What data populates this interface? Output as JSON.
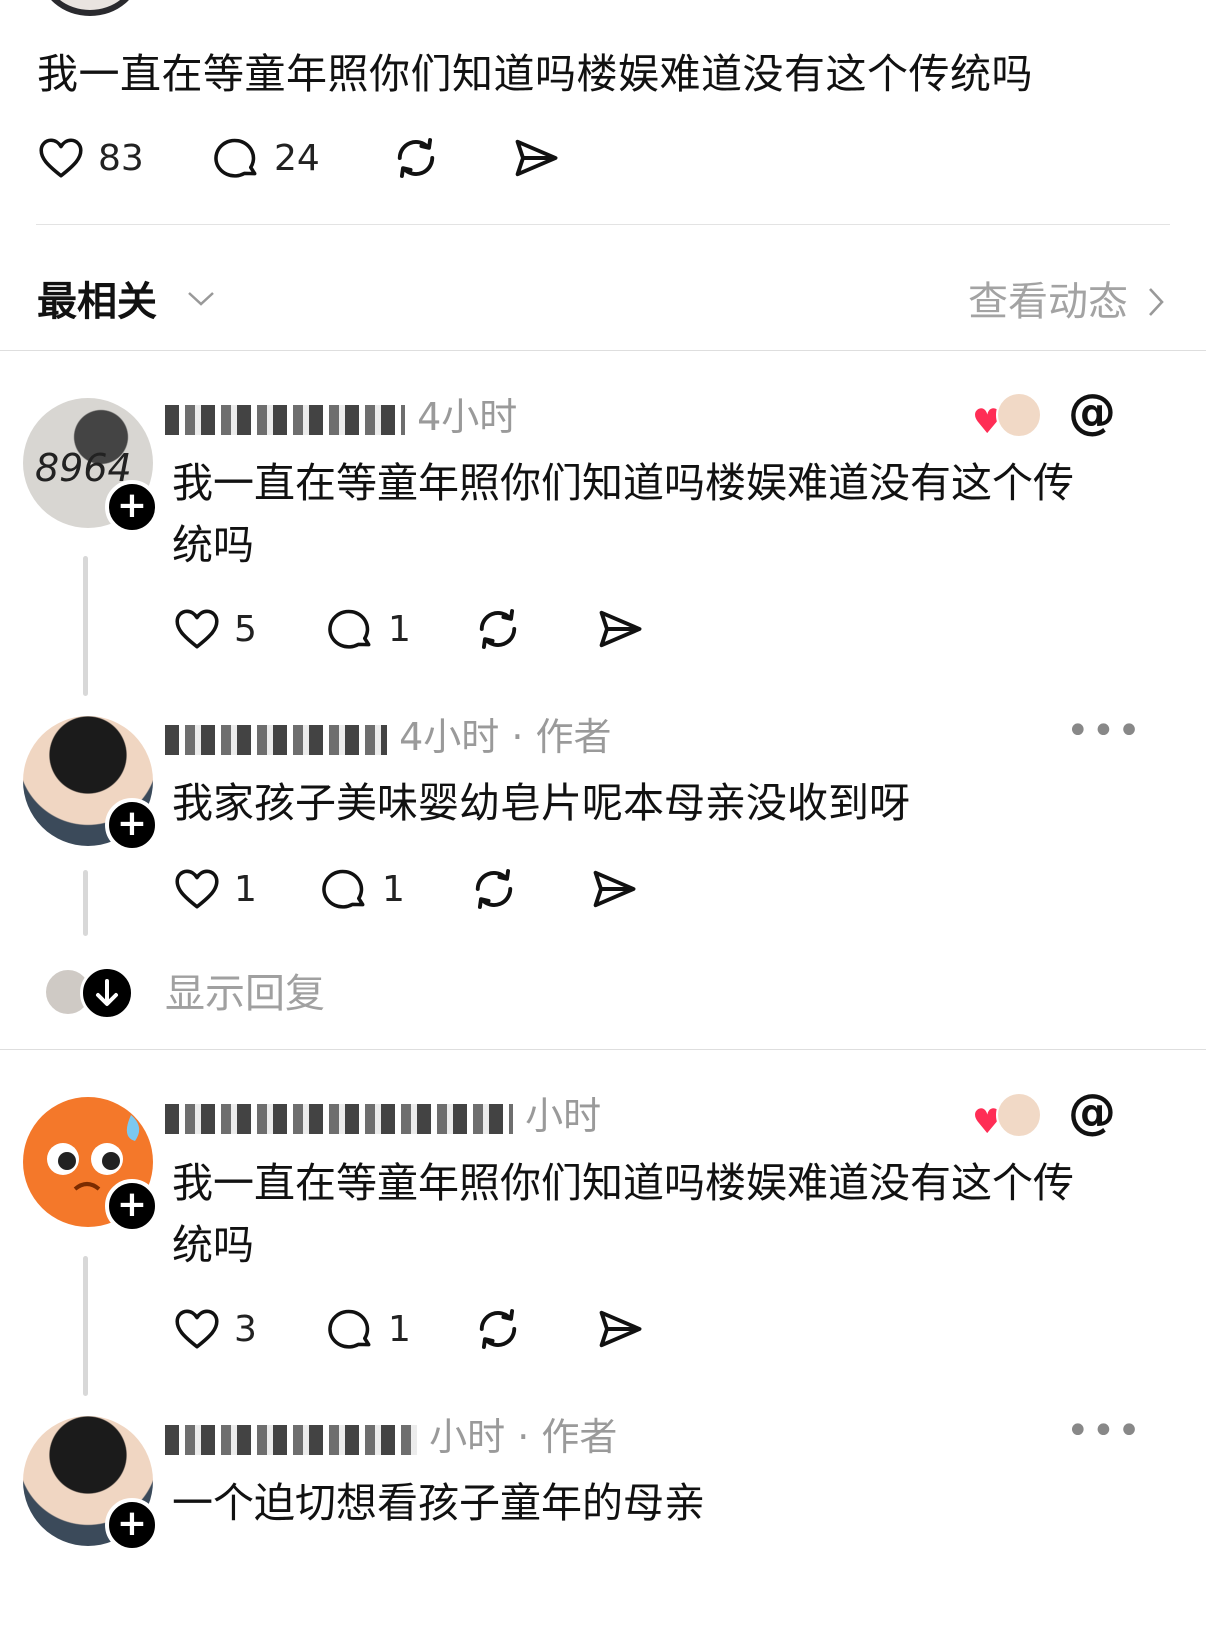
{
  "post": {
    "text": "我一直在等童年照你们知道吗楼娱难道没有这个传统吗",
    "likes": "83",
    "comments": "24"
  },
  "sort": {
    "label": "最相关",
    "activity": "查看动态"
  },
  "comments": [
    {
      "avatar_text": "8964",
      "time": "4小时",
      "author_tag": "",
      "text_line1": "我一直在等童年照你们知道吗楼娱难道没有这个传",
      "text_line2": "统吗",
      "likes": "5",
      "replies": "1"
    },
    {
      "time": "4小时",
      "author_tag": "· 作者",
      "text": "我家孩子美味婴幼皂片呢本母亲没收到呀",
      "likes": "1",
      "replies": "1"
    },
    {
      "time": "小时",
      "author_tag": "",
      "text_line1": "我一直在等童年照你们知道吗楼娱难道没有这个传",
      "text_line2": "统吗",
      "likes": "3",
      "replies": "1"
    },
    {
      "time": "小时",
      "author_tag": "· 作者",
      "text": "一个迫切想看孩子童年的母亲"
    }
  ],
  "show_replies": "显示回复",
  "colors": {
    "like_red": "#ff2d55",
    "muted": "#a0a0a0",
    "divider": "#dedede"
  },
  "icons": [
    "heart-icon",
    "comment-icon",
    "repost-icon",
    "share-icon",
    "chevron-down-icon",
    "chevron-right-icon",
    "plus-icon",
    "threads-icon",
    "more-icon",
    "arrow-down-icon"
  ]
}
